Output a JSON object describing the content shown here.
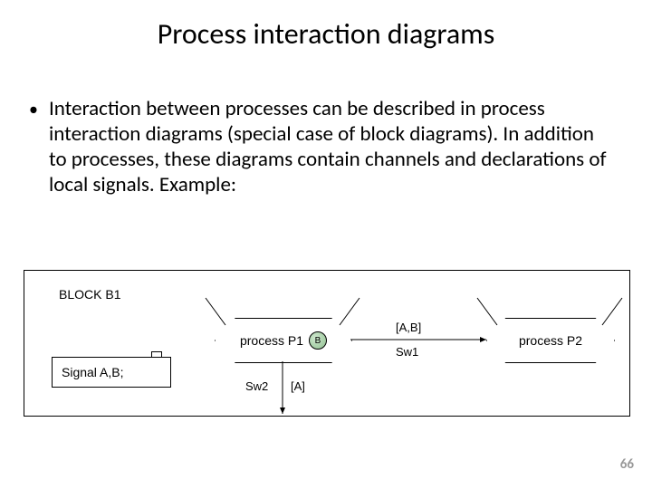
{
  "title": "Process interaction diagrams",
  "bullet1": "Interaction between processes can be described in process interaction diagrams (special case of block diagrams). In addition to processes, these diagrams contain channels and declarations of local signals. Example:",
  "pageNumber": "66",
  "diagram": {
    "blockLabel": "BLOCK B1",
    "signalDecl": "Signal A,B;",
    "process1": "process P1",
    "process1State": "B",
    "process2": "process P2",
    "sw1": "Sw1",
    "sw1Sig": "[A,B]",
    "sw2": "Sw2",
    "sw2Sig": "[A]"
  }
}
